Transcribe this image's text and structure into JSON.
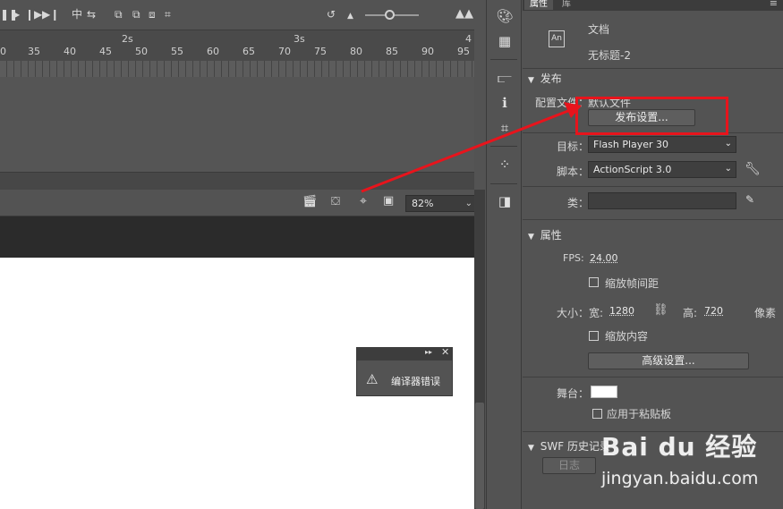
{
  "timeline": {
    "controls": [
      "⏸",
      "▶",
      "⏭",
      "⏭"
    ],
    "second_labels": [
      "2s",
      "3s",
      "4"
    ],
    "frame_labels": [
      "0",
      "35",
      "40",
      "45",
      "50",
      "55",
      "60",
      "65",
      "70",
      "75",
      "80",
      "85",
      "90",
      "95"
    ]
  },
  "stage": {
    "zoom": "82%"
  },
  "compiler_panel": {
    "title": "编译器错误"
  },
  "tabs": {
    "properties": "属性",
    "library": "库"
  },
  "document": {
    "icon_text": "An",
    "type_label": "文档",
    "name": "无标题-2"
  },
  "publish": {
    "section_title": "发布",
    "profile_label": "配置文件：",
    "profile_value": "默认文件",
    "settings_button": "发布设置...",
    "target_label": "目标：",
    "target_value": "Flash Player 30",
    "script_label": "脚本：",
    "script_value": "ActionScript 3.0",
    "class_label": "类："
  },
  "properties": {
    "section_title": "属性",
    "fps_label": "FPS:",
    "fps_value": "24.00",
    "scale_interval_label": "缩放帧间距",
    "size_label": "大小：",
    "width_label": "宽:",
    "width_value": "1280",
    "height_label": "高:",
    "height_value": "720",
    "unit": "像素",
    "scale_content_label": "缩放内容",
    "advanced_button": "高级设置...",
    "stage_label": "舞台：",
    "stage_color": "#ffffff",
    "apply_pasteboard_label": "应用于粘贴板"
  },
  "swf_history": {
    "section_title": "SWF 历史记录",
    "log_button": "日志"
  },
  "watermark": {
    "brand": "Bai du 经验",
    "url": "jingyan.baidu.com"
  },
  "colors": {
    "annotation": "#e8141c",
    "panel_bg": "#535353"
  }
}
